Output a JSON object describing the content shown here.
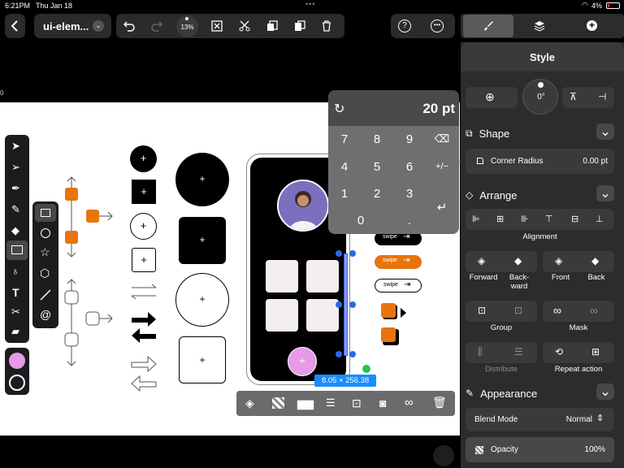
{
  "status": {
    "time": "6:21PM",
    "date": "Thu Jan 18",
    "battery": "4%"
  },
  "toolbar": {
    "doc_title": "ui-elem...",
    "zoom": "13%"
  },
  "right_tabs": {
    "style_icon": "paintbrush-icon",
    "layers_icon": "layers-icon",
    "add_icon": "plus-icon"
  },
  "style_panel": {
    "title": "Style",
    "rotation": "0°",
    "shape": {
      "header": "Shape",
      "corner_radius_label": "Corner Radius",
      "corner_radius_value": "0.00 pt"
    },
    "arrange": {
      "header": "Arrange",
      "alignment_label": "Alignment",
      "forward": "Forward",
      "backward": "Back-\nward",
      "front": "Front",
      "back": "Back",
      "group": "Group",
      "mask": "Mask",
      "distribute": "Distribute",
      "repeat_action": "Repeat action"
    },
    "appearance": {
      "header": "Appearance",
      "blend_mode_label": "Blend Mode",
      "blend_mode_value": "Normal",
      "opacity_label": "Opacity",
      "opacity_value": "100%"
    }
  },
  "keypad": {
    "value": "20 pt",
    "keys": [
      "7",
      "8",
      "9",
      "4",
      "5",
      "6",
      "1",
      "2",
      "3",
      "0",
      "."
    ],
    "plus_minus": "+/−"
  },
  "canvas": {
    "swipe_labels": [
      "swipe",
      "swipe",
      "swipe"
    ],
    "dimension_label": "8.05 × 256.38",
    "ruler_mark": "0"
  },
  "colors": {
    "fill": "#e79ae8",
    "accent": "#e8740c",
    "selection": "#2a6ae8",
    "dimension_bg": "#1a8cff"
  }
}
